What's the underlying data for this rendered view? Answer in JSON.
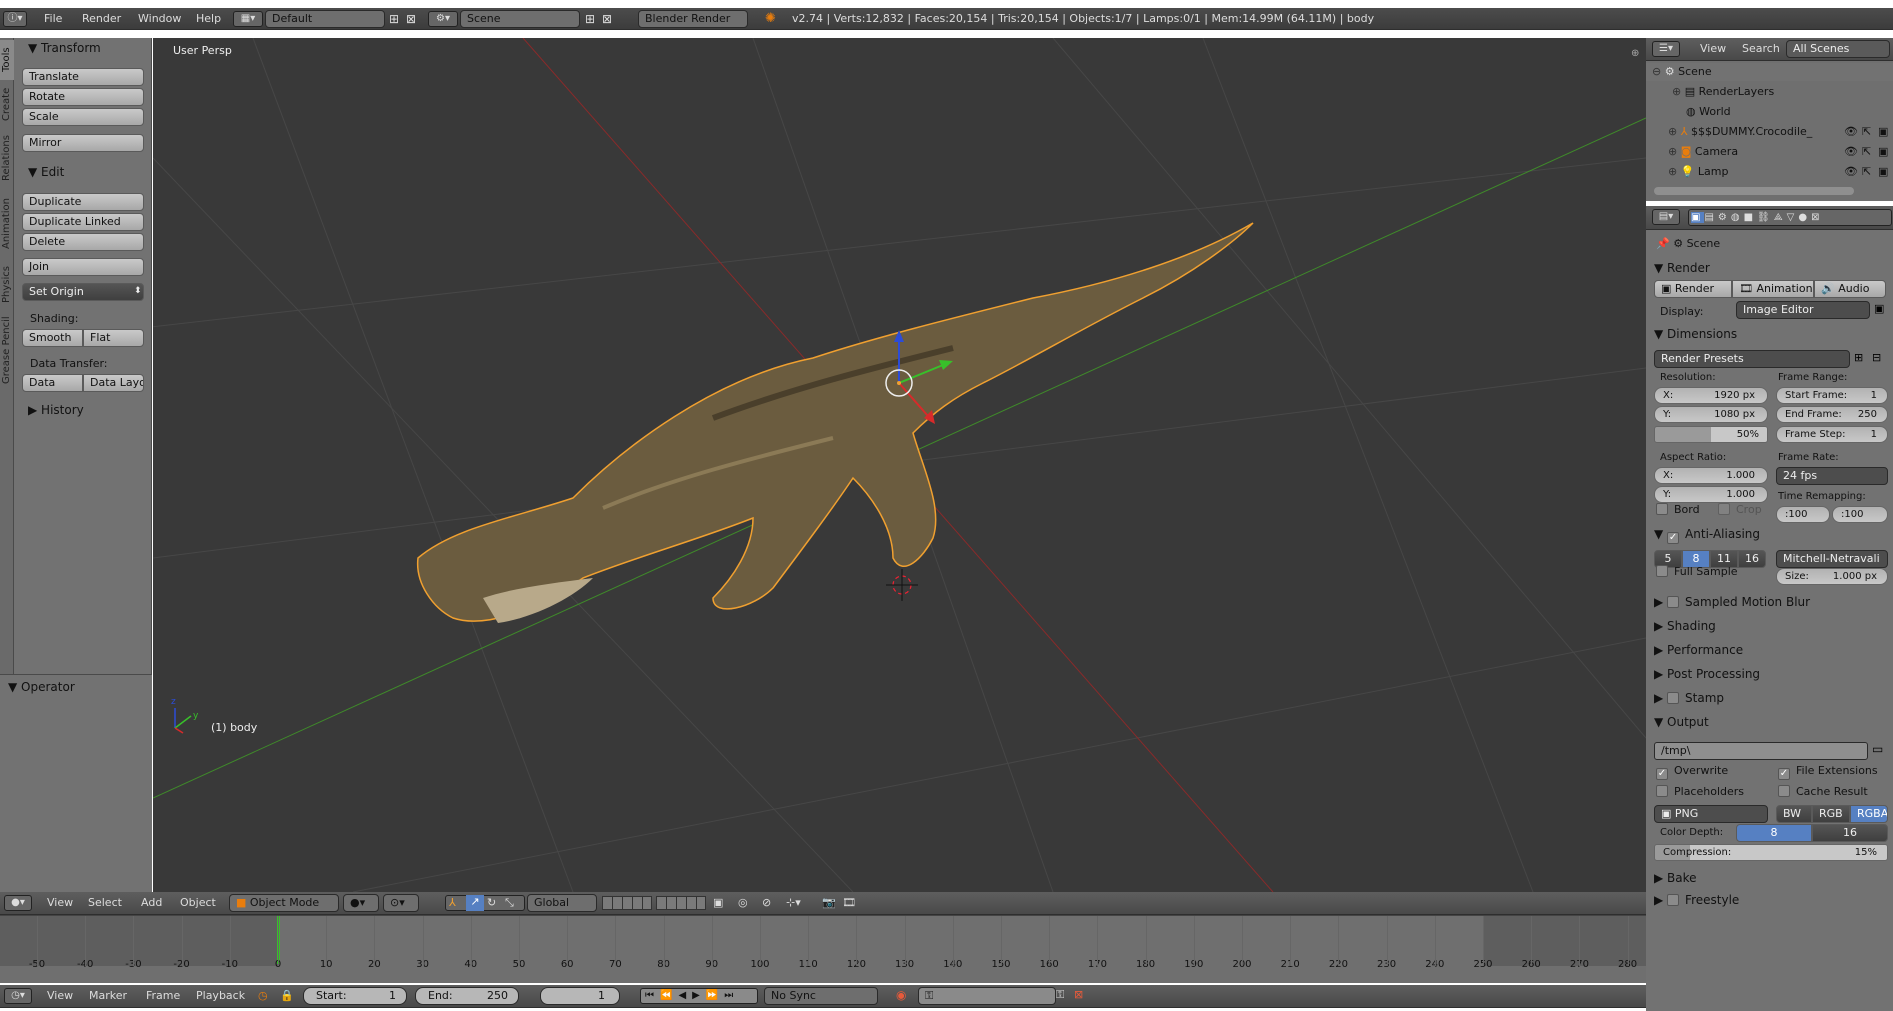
{
  "top_bar": {
    "menus": [
      "File",
      "Render",
      "Window",
      "Help"
    ],
    "layout": "Default",
    "scene": "Scene",
    "engine": "Blender Render",
    "stats": "v2.74 | Verts:12,832 | Faces:20,154 | Tris:20,154 | Objects:1/7 | Lamps:0/1 | Mem:14.99M (64.11M) | body"
  },
  "tool_tabs": [
    "Tools",
    "Create",
    "Relations",
    "Animation",
    "Physics",
    "Grease Pencil"
  ],
  "toolshelf": {
    "transform_title": "Transform",
    "translate": "Translate",
    "rotate": "Rotate",
    "scale": "Scale",
    "mirror": "Mirror",
    "edit_title": "Edit",
    "duplicate": "Duplicate",
    "duplicate_linked": "Duplicate Linked",
    "delete": "Delete",
    "join": "Join",
    "set_origin": "Set Origin",
    "shading_label": "Shading:",
    "smooth": "Smooth",
    "flat": "Flat",
    "data_transfer_label": "Data Transfer:",
    "data": "Data",
    "data_layo": "Data Layo",
    "history_title": "History",
    "operator_title": "Operator"
  },
  "viewport": {
    "view_label": "User Persp",
    "object_label": "(1) body"
  },
  "viewport_header": {
    "menus": [
      "View",
      "Select",
      "Add",
      "Object"
    ],
    "mode": "Object Mode",
    "orientation": "Global"
  },
  "timeline": {
    "ticks": [
      "-50",
      "-40",
      "-30",
      "-20",
      "-10",
      "0",
      "10",
      "20",
      "30",
      "40",
      "50",
      "60",
      "70",
      "80",
      "90",
      "100",
      "110",
      "120",
      "130",
      "140",
      "150",
      "160",
      "170",
      "180",
      "190",
      "200",
      "210",
      "220",
      "230",
      "240",
      "250",
      "260",
      "270",
      "280"
    ],
    "current_frame": 0,
    "menus": [
      "View",
      "Marker",
      "Frame",
      "Playback"
    ],
    "start_label": "Start:",
    "start": "1",
    "end_label": "End:",
    "end": "250",
    "frame": "1",
    "sync": "No Sync"
  },
  "outliner": {
    "menus": [
      "View",
      "Search"
    ],
    "filter": "All Scenes",
    "items": [
      "Scene",
      "RenderLayers",
      "World",
      "$$$DUMMY.Crocodile_",
      "Camera",
      "Lamp"
    ]
  },
  "properties": {
    "context": "Scene",
    "render_title": "Render",
    "render_btn": "Render",
    "animation_btn": "Animation",
    "audio_btn": "Audio",
    "display_label": "Display:",
    "display_value": "Image Editor",
    "dimensions_title": "Dimensions",
    "render_presets": "Render Presets",
    "resolution_label": "Resolution:",
    "res_x_label": "X:",
    "res_x": "1920 px",
    "res_y_label": "Y:",
    "res_y": "1080 px",
    "res_pct": "50%",
    "frame_range_label": "Frame Range:",
    "start_frame_label": "Start Frame:",
    "start_frame": "1",
    "end_frame_label": "End Frame:",
    "end_frame": "250",
    "frame_step_label": "Frame Step:",
    "frame_step": "1",
    "aspect_label": "Aspect Ratio:",
    "aspect_x_label": "X:",
    "aspect_x": "1.000",
    "aspect_y_label": "Y:",
    "aspect_y": "1.000",
    "frame_rate_label": "Frame Rate:",
    "fps": "24 fps",
    "time_remap_label": "Time Remapping:",
    "remap_old": ":100",
    "remap_new": ":100",
    "bord": "Bord",
    "crop": "Crop",
    "aa_title": "Anti-Aliasing",
    "aa_samples": [
      "5",
      "8",
      "11",
      "16"
    ],
    "aa_selected": "8",
    "aa_filter": "Mitchell-Netravali",
    "full_sample": "Full Sample",
    "size_label": "Size:",
    "size": "1.000 px",
    "smb_title": "Sampled Motion Blur",
    "shading_title": "Shading",
    "performance_title": "Performance",
    "post_title": "Post Processing",
    "stamp_title": "Stamp",
    "output_title": "Output",
    "output_path": "/tmp\\",
    "overwrite": "Overwrite",
    "file_ext": "File Extensions",
    "placeholders": "Placeholders",
    "cache_result": "Cache Result",
    "format": "PNG",
    "bw": "BW",
    "rgb": "RGB",
    "rgba": "RGBA",
    "color_depth_label": "Color Depth:",
    "depth_8": "8",
    "depth_16": "16",
    "compression_label": "Compression:",
    "compression": "15%",
    "bake_title": "Bake",
    "freestyle_title": "Freestyle"
  },
  "colors": {
    "accent_blue": "#5680c2",
    "viewport_bg": "#393939",
    "selection_orange": "#f0a030"
  }
}
